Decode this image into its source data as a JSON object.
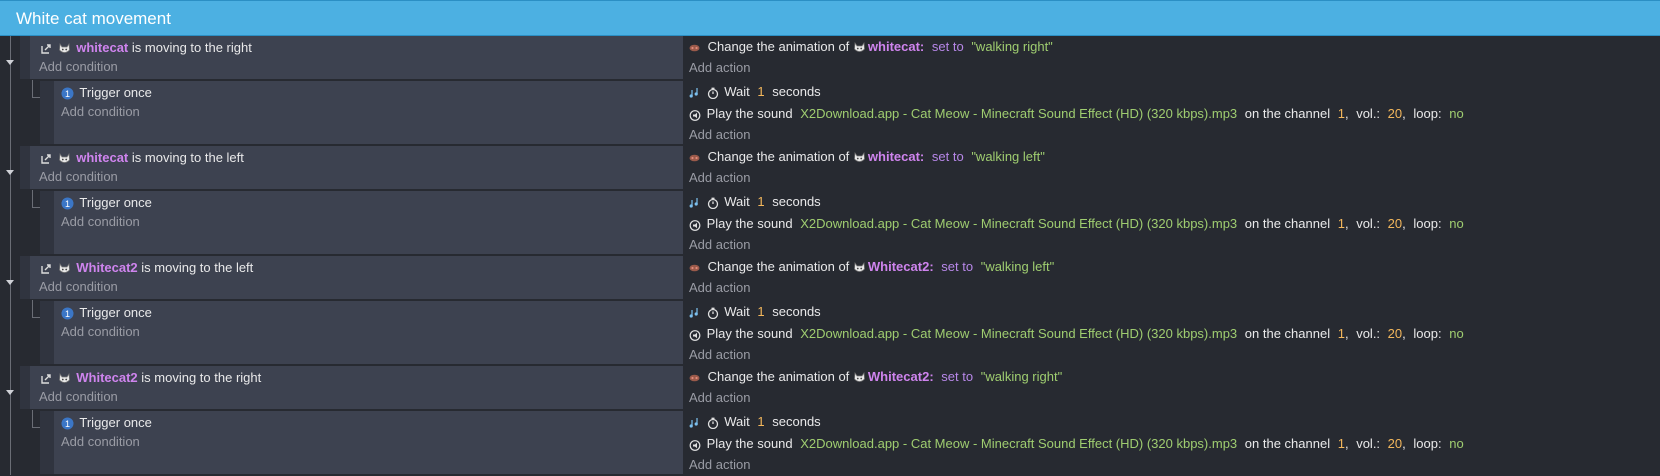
{
  "group": {
    "title": "White cat movement"
  },
  "labels": {
    "add_condition": "Add condition",
    "add_action": "Add action",
    "trigger_once": "Trigger once",
    "change_animation": "Change the animation of",
    "set_to": "set to",
    "wait": "Wait",
    "seconds": "seconds",
    "play_sound": "Play the sound",
    "on_channel": "on the channel",
    "vol": "vol.:",
    "loop": "loop:"
  },
  "events": [
    {
      "object": "whitecat",
      "condition": "is moving to the right",
      "animation": "\"walking right\""
    },
    {
      "object": "whitecat",
      "condition": "is moving to the left",
      "animation": "\"walking left\""
    },
    {
      "object": "Whitecat2",
      "condition": "is moving to the left",
      "animation": "\"walking left\""
    },
    {
      "object": "Whitecat2",
      "condition": "is moving to the right",
      "animation": "\"walking right\""
    }
  ],
  "wait_seconds": "1",
  "sound": {
    "file": "X2Download.app - Cat Meow - Minecraft Sound Effect (HD) (320 kbps).mp3",
    "channel": "1",
    "volume": "20",
    "loop": "no"
  },
  "icons": {
    "condition": "movement-arrow-icon",
    "object": "cat-sprite-icon",
    "trigger": "trigger-once-badge-icon",
    "animation": "animation-icon",
    "wait": "stopwatch-icon",
    "sound": "sound-icon"
  },
  "colors": {
    "header": "#4cb0e2",
    "background": "#272a31",
    "condition_bg": "#3d4250",
    "object_name": "#cf84ee",
    "string": "#9fcd70",
    "number": "#f3b75c",
    "keyword": "#b787e8"
  }
}
